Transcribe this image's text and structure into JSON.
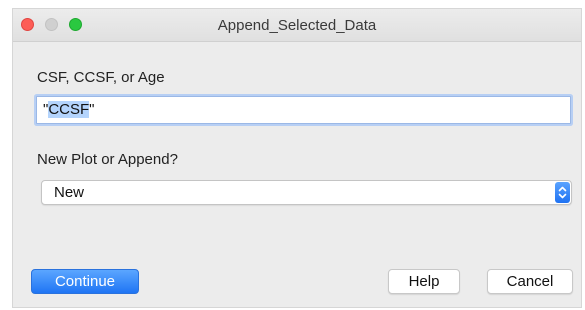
{
  "window": {
    "title": "Append_Selected_Data"
  },
  "fields": {
    "type_label": "CSF, CCSF, or Age",
    "type_value_quote_open": "\"",
    "type_value_selected": "CCSF",
    "type_value_quote_close": "\"",
    "mode_label": "New Plot or Append?",
    "mode_selected": "New"
  },
  "buttons": {
    "continue_label": "Continue",
    "help_label": "Help",
    "cancel_label": "Cancel"
  },
  "icons": {
    "close": "close-traffic-light",
    "minimize": "minimize-traffic-light",
    "maximize": "maximize-traffic-light",
    "select_arrows": "up-down-chevrons-icon"
  },
  "colors": {
    "accent": "#1f75f4",
    "close": "#fd5d56",
    "maximize": "#2ac840",
    "selection": "#b4d4fc"
  }
}
